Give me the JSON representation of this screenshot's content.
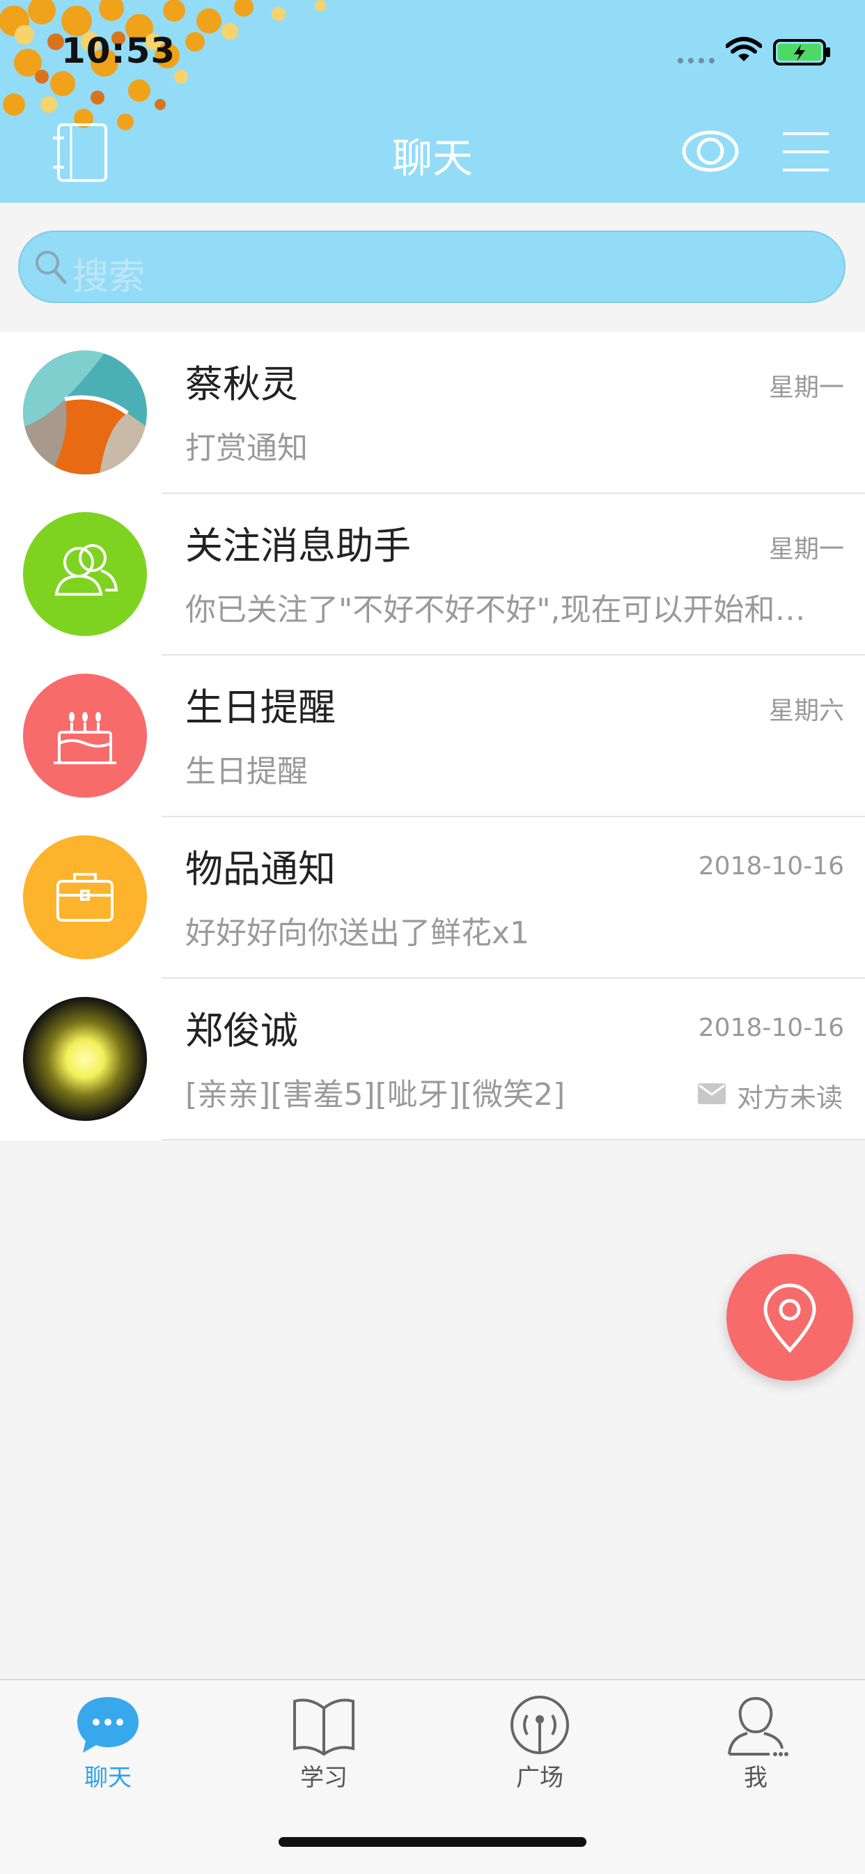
{
  "status_bar": {
    "time": "10:53"
  },
  "header": {
    "title": "聊天"
  },
  "search": {
    "placeholder": "搜索"
  },
  "chats": [
    {
      "name": "蔡秋灵",
      "time": "星期一",
      "preview": "打赏通知"
    },
    {
      "name": "关注消息助手",
      "time": "星期一",
      "preview": "你已关注了\"不好不好不好\",现在可以开始和他聊天了"
    },
    {
      "name": "生日提醒",
      "time": "星期六",
      "preview": "生日提醒"
    },
    {
      "name": "物品通知",
      "time": "2018-10-16",
      "preview": "好好好向你送出了鲜花x1"
    },
    {
      "name": "郑俊诚",
      "time": "2018-10-16",
      "preview": "[亲亲][害羞5][呲牙][微笑2]",
      "status": "对方未读"
    }
  ],
  "tabs": [
    {
      "label": "聊天",
      "icon": "chat-bubble-icon",
      "active": true
    },
    {
      "label": "学习",
      "icon": "book-icon"
    },
    {
      "label": "广场",
      "icon": "broadcast-icon"
    },
    {
      "label": "我",
      "icon": "person-icon"
    }
  ],
  "colors": {
    "header_bg": "#93dcf8",
    "accent_blue": "#2ea3e6",
    "fab_red": "#f76b6b",
    "assistant_green": "#7ed321",
    "birthday_red": "#f76b6b",
    "item_orange": "#fdb32b"
  }
}
